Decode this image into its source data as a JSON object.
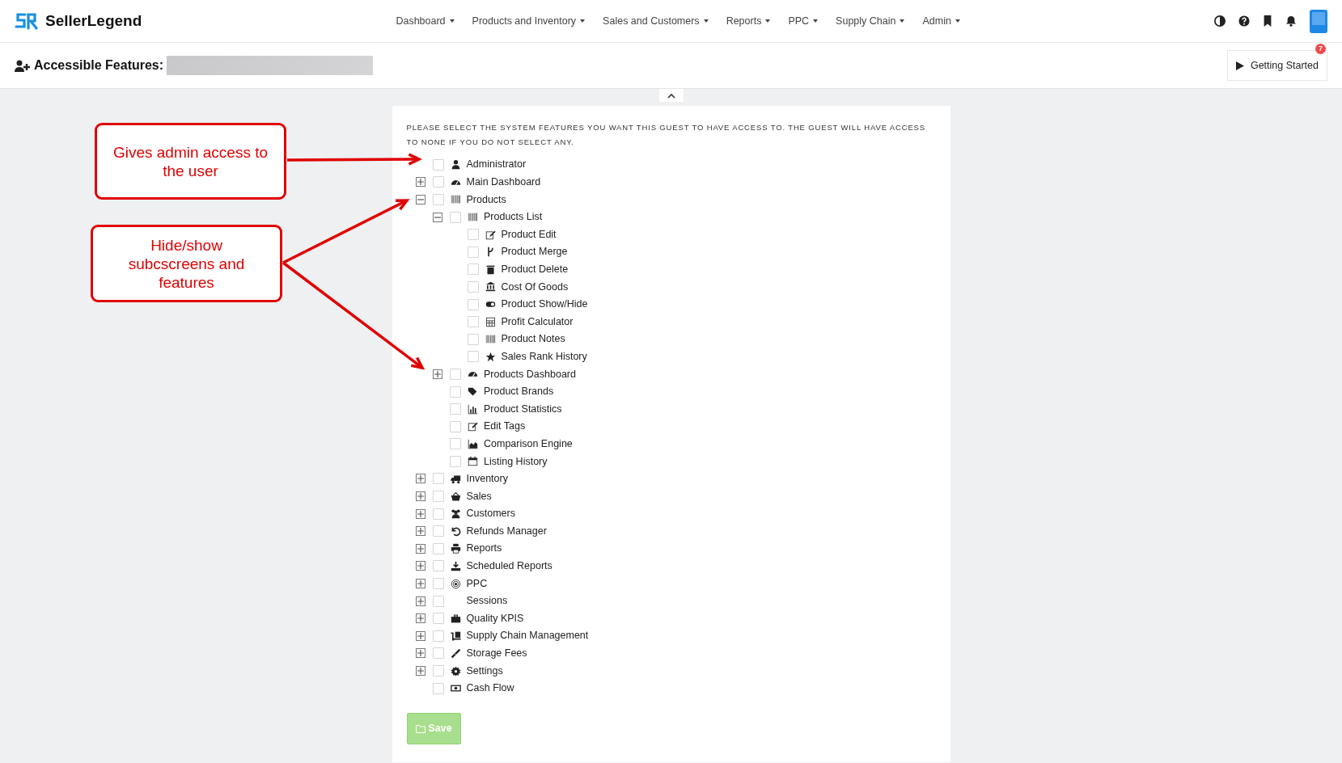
{
  "brand": {
    "name": "SellerLegend"
  },
  "nav": [
    {
      "label": "Dashboard"
    },
    {
      "label": "Products and Inventory"
    },
    {
      "label": "Sales and Customers"
    },
    {
      "label": "Reports"
    },
    {
      "label": "PPC"
    },
    {
      "label": "Supply Chain"
    },
    {
      "label": "Admin"
    }
  ],
  "page_header": {
    "title": "Accessible Features:",
    "getting_started": {
      "label": "Getting Started",
      "badge": "7"
    }
  },
  "panel": {
    "instructions": "PLEASE SELECT THE SYSTEM FEATURES YOU WANT THIS GUEST TO HAVE ACCESS TO. THE GUEST WILL HAVE ACCESS TO NONE IF YOU DO NOT SELECT ANY.",
    "tree": [
      {
        "label": "Administrator",
        "checked": false
      },
      {
        "label": "Main Dashboard",
        "checked": false,
        "expanded": false
      },
      {
        "label": "Products",
        "checked": false,
        "expanded": true,
        "children": [
          {
            "label": "Products List",
            "checked": false,
            "expanded": true,
            "children": [
              {
                "label": "Product Edit",
                "checked": false
              },
              {
                "label": "Product Merge",
                "checked": false
              },
              {
                "label": "Product Delete",
                "checked": false
              },
              {
                "label": "Cost Of Goods",
                "checked": false
              },
              {
                "label": "Product Show/Hide",
                "checked": false
              },
              {
                "label": "Profit Calculator",
                "checked": false
              },
              {
                "label": "Product Notes",
                "checked": false
              },
              {
                "label": "Sales Rank History",
                "checked": false
              }
            ]
          },
          {
            "label": "Products Dashboard",
            "checked": false,
            "expanded": false
          },
          {
            "label": "Product Brands",
            "checked": false
          },
          {
            "label": "Product Statistics",
            "checked": false
          },
          {
            "label": "Edit Tags",
            "checked": false
          },
          {
            "label": "Comparison Engine",
            "checked": false
          },
          {
            "label": "Listing History",
            "checked": false
          }
        ]
      },
      {
        "label": "Inventory",
        "checked": false,
        "expanded": false
      },
      {
        "label": "Sales",
        "checked": false,
        "expanded": false
      },
      {
        "label": "Customers",
        "checked": false,
        "expanded": false
      },
      {
        "label": "Refunds Manager",
        "checked": false,
        "expanded": false
      },
      {
        "label": "Reports",
        "checked": false,
        "expanded": false
      },
      {
        "label": "Scheduled Reports",
        "checked": false,
        "expanded": false
      },
      {
        "label": "PPC",
        "checked": false,
        "expanded": false
      },
      {
        "label": "Sessions",
        "checked": false,
        "expanded": false
      },
      {
        "label": "Quality KPIS",
        "checked": false,
        "expanded": false
      },
      {
        "label": "Supply Chain Management",
        "checked": false,
        "expanded": false
      },
      {
        "label": "Storage Fees",
        "checked": false,
        "expanded": false
      },
      {
        "label": "Settings",
        "checked": false,
        "expanded": false
      },
      {
        "label": "Cash Flow",
        "checked": false
      }
    ],
    "save_button": {
      "label": "Save",
      "disabled": true
    }
  },
  "annotations": [
    {
      "text": "Gives admin access to the user"
    },
    {
      "text": "Hide/show subcscreens and features"
    }
  ]
}
